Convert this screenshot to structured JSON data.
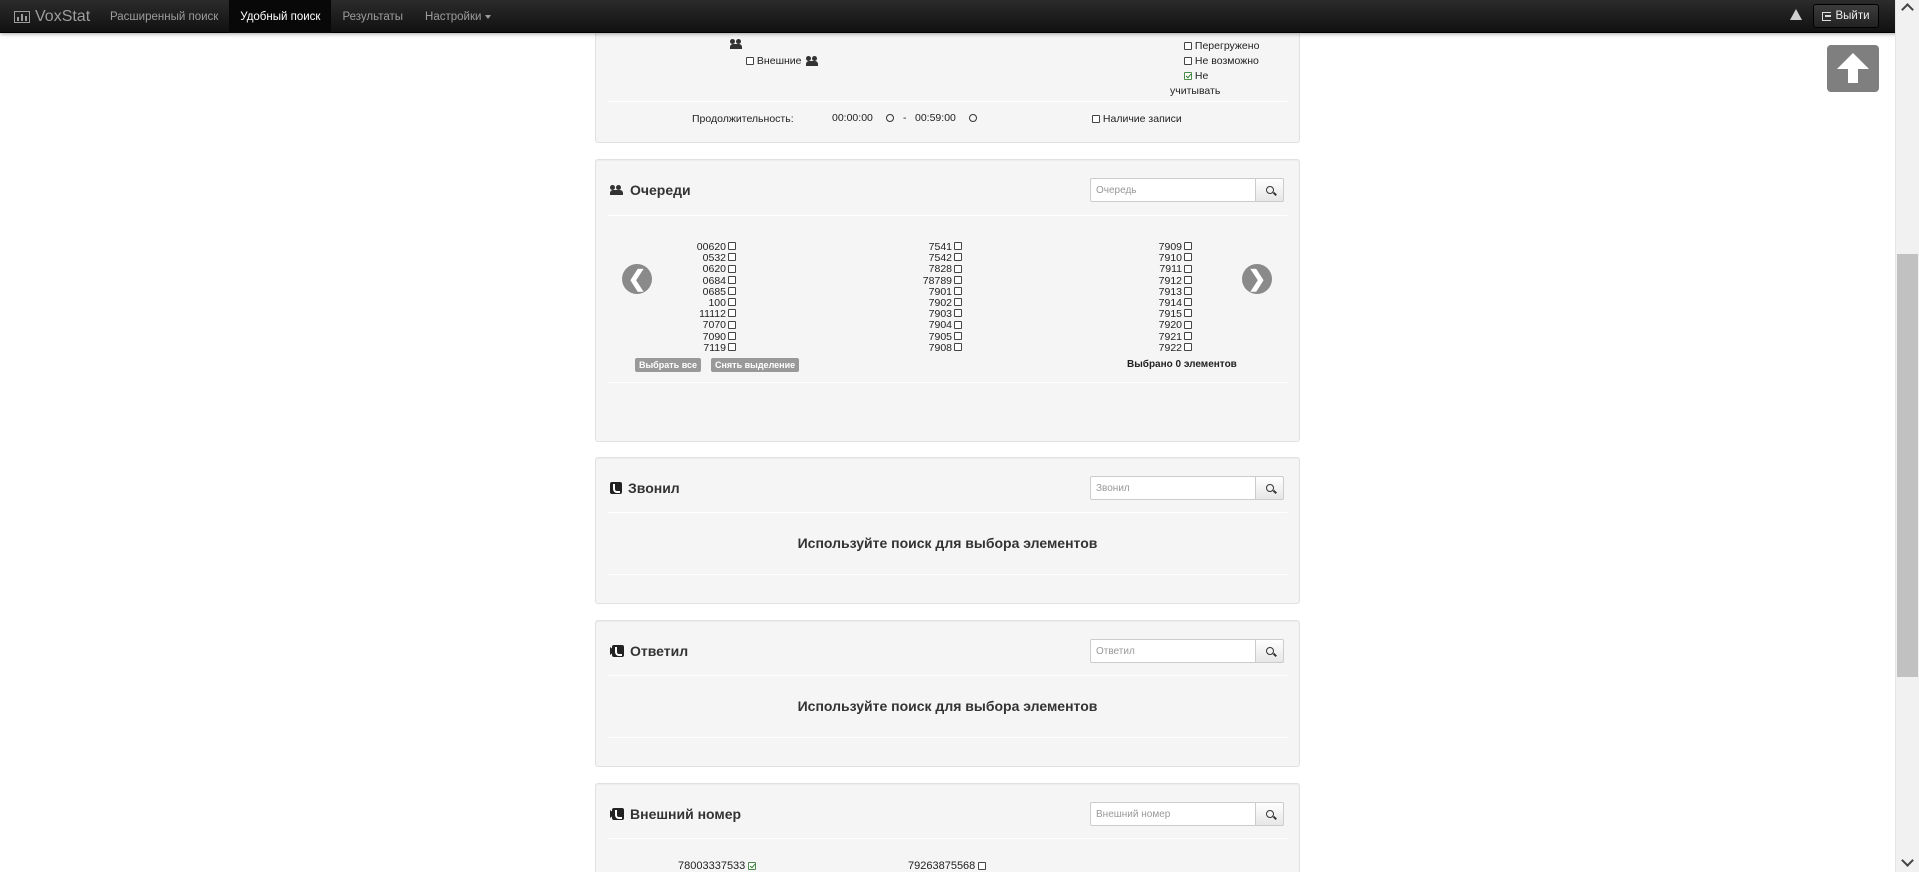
{
  "navbar": {
    "brand": "VoxStat",
    "items": [
      {
        "label": "Расширенный поиск"
      },
      {
        "label": "Удобный поиск"
      },
      {
        "label": "Результаты"
      },
      {
        "label": "Настройки"
      }
    ],
    "logout_label": "Выйти"
  },
  "filters": {
    "external_label": "Внешние",
    "status_options": [
      {
        "label": "Перегружено",
        "checked": false
      },
      {
        "label": "Не возможно",
        "checked": false
      },
      {
        "label": "Не",
        "label2": "учитывать",
        "checked": true
      }
    ],
    "duration_label": "Продолжительность:",
    "duration_from": "00:00:00",
    "duration_sep": "-",
    "duration_to": "00:59:00",
    "has_record_label": "Наличие записи"
  },
  "queues": {
    "title": "Очереди",
    "search_placeholder": "Очередь",
    "columns": [
      [
        "00620",
        "0532",
        "0620",
        "0684",
        "0685",
        "100",
        "11112",
        "7070",
        "7090",
        "7119"
      ],
      [
        "7541",
        "7542",
        "7828",
        "78789",
        "7901",
        "7902",
        "7903",
        "7904",
        "7905",
        "7908"
      ],
      [
        "7909",
        "7910",
        "7911",
        "7912",
        "7913",
        "7914",
        "7915",
        "7920",
        "7921",
        "7922"
      ]
    ],
    "prev": "❮",
    "next": "❯",
    "select_all": "Выбрать все",
    "deselect": "Снять выделение",
    "selected_count": "Выбрано 0 элементов"
  },
  "caller": {
    "title": "Звонил",
    "search_placeholder": "Звонил",
    "empty": "Используйте поиск для выбора элементов"
  },
  "answered": {
    "title": "Ответил",
    "search_placeholder": "Ответил",
    "empty": "Используйте поиск для выбора элементов"
  },
  "external_number": {
    "title": "Внешний номер",
    "search_placeholder": "Внешний номер",
    "items": [
      {
        "label": "78003337533",
        "checked": true
      },
      {
        "label": "79263875568",
        "checked": false
      }
    ]
  }
}
